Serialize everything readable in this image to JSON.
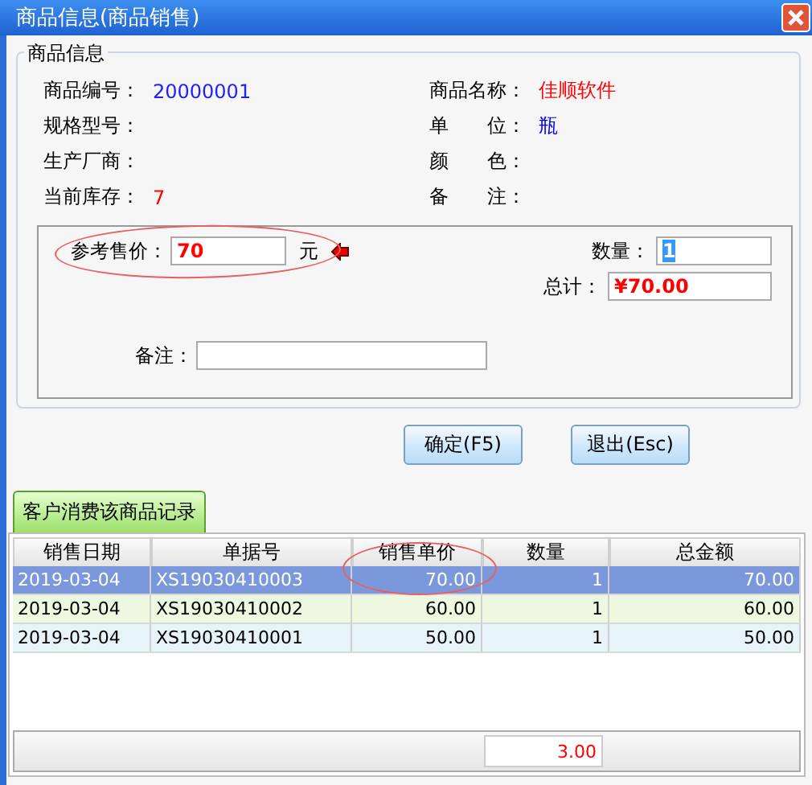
{
  "window": {
    "title": "商品信息(商品销售)"
  },
  "product_info": {
    "title": "商品信息",
    "fields": [
      {
        "label": "商品编号：",
        "value": "20000001",
        "color": "#2020ff"
      },
      {
        "label": "商品名称：",
        "value": "佳顺软件",
        "color": "#ff0000"
      },
      {
        "label": "规格型号："
      },
      {
        "label": "单　　位：",
        "value": "瓶",
        "color": "#0000ff"
      },
      {
        "label": "生产厂商："
      },
      {
        "label": "颜　　色："
      },
      {
        "label": "当前库存：",
        "value": "7",
        "color": "#ff0000"
      },
      {
        "label": "备　　注："
      }
    ]
  },
  "sale": {
    "price": {
      "label": "参考售价：",
      "value": "70",
      "unit": "元"
    },
    "quantity": {
      "label": "数量：",
      "value": "1",
      "selected": true
    },
    "total": {
      "label": "总计：",
      "value": "¥70.00"
    },
    "note": {
      "label": "备注："
    }
  },
  "buttons": [
    "确定(F5)",
    "退出(Esc)"
  ],
  "tabs": [
    {
      "label": "客户消费该商品记录",
      "selected": true
    }
  ],
  "table": {
    "columns": [
      "销售日期",
      "单据号",
      "销售单价",
      "数量",
      "总金额"
    ],
    "rows": [
      {
        "cells": [
          "2019-03-04",
          "XS19030410003",
          "70.00",
          "1",
          "70.00"
        ],
        "selected": true
      },
      {
        "cells": [
          "2019-03-04",
          "XS19030410002",
          "60.00",
          "1",
          "60.00"
        ],
        "selected": false
      },
      {
        "cells": [
          "2019-03-04",
          "XS19030410001",
          "50.00",
          "1",
          "50.00"
        ],
        "selected": false
      }
    ],
    "footer": {
      "quantity_total": "3.00"
    }
  }
}
